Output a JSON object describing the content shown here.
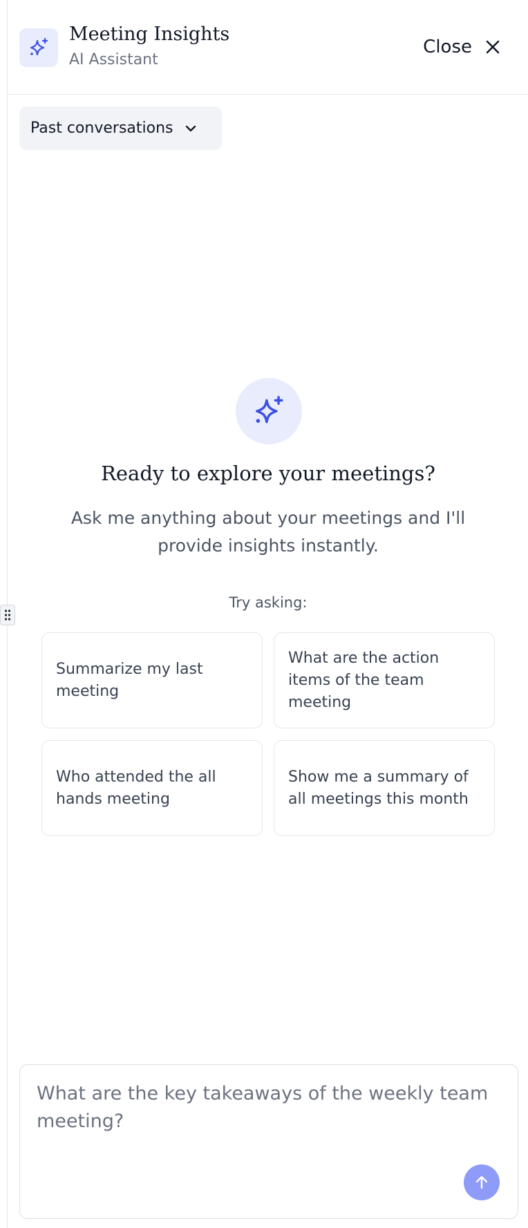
{
  "header": {
    "title": "Meeting Insights",
    "subtitle": "AI Assistant",
    "close_label": "Close",
    "logo_icon": "sparkle-icon",
    "close_icon": "close-icon"
  },
  "history": {
    "label": "Past conversations",
    "icon": "chevron-down-icon"
  },
  "empty_state": {
    "icon": "sparkle-icon",
    "title": "Ready to explore your meetings?",
    "description": "Ask me anything about your meetings and I'll provide insights instantly.",
    "try_label": "Try asking:"
  },
  "suggestions": [
    "Summarize my last meeting",
    "What are the action items of the team meeting",
    "Who attended the all hands meeting",
    "Show me a summary of all meetings this month"
  ],
  "composer": {
    "placeholder": "What are the key takeaways of the weekly team meeting?",
    "value": "",
    "send_icon": "arrow-up-icon"
  },
  "colors": {
    "accent": "#3b4fe4",
    "accent_soft": "#e8ecfd",
    "send_button": "#8e9bf8",
    "chip_bg": "#f1f3f7",
    "border": "#e5e7eb"
  }
}
